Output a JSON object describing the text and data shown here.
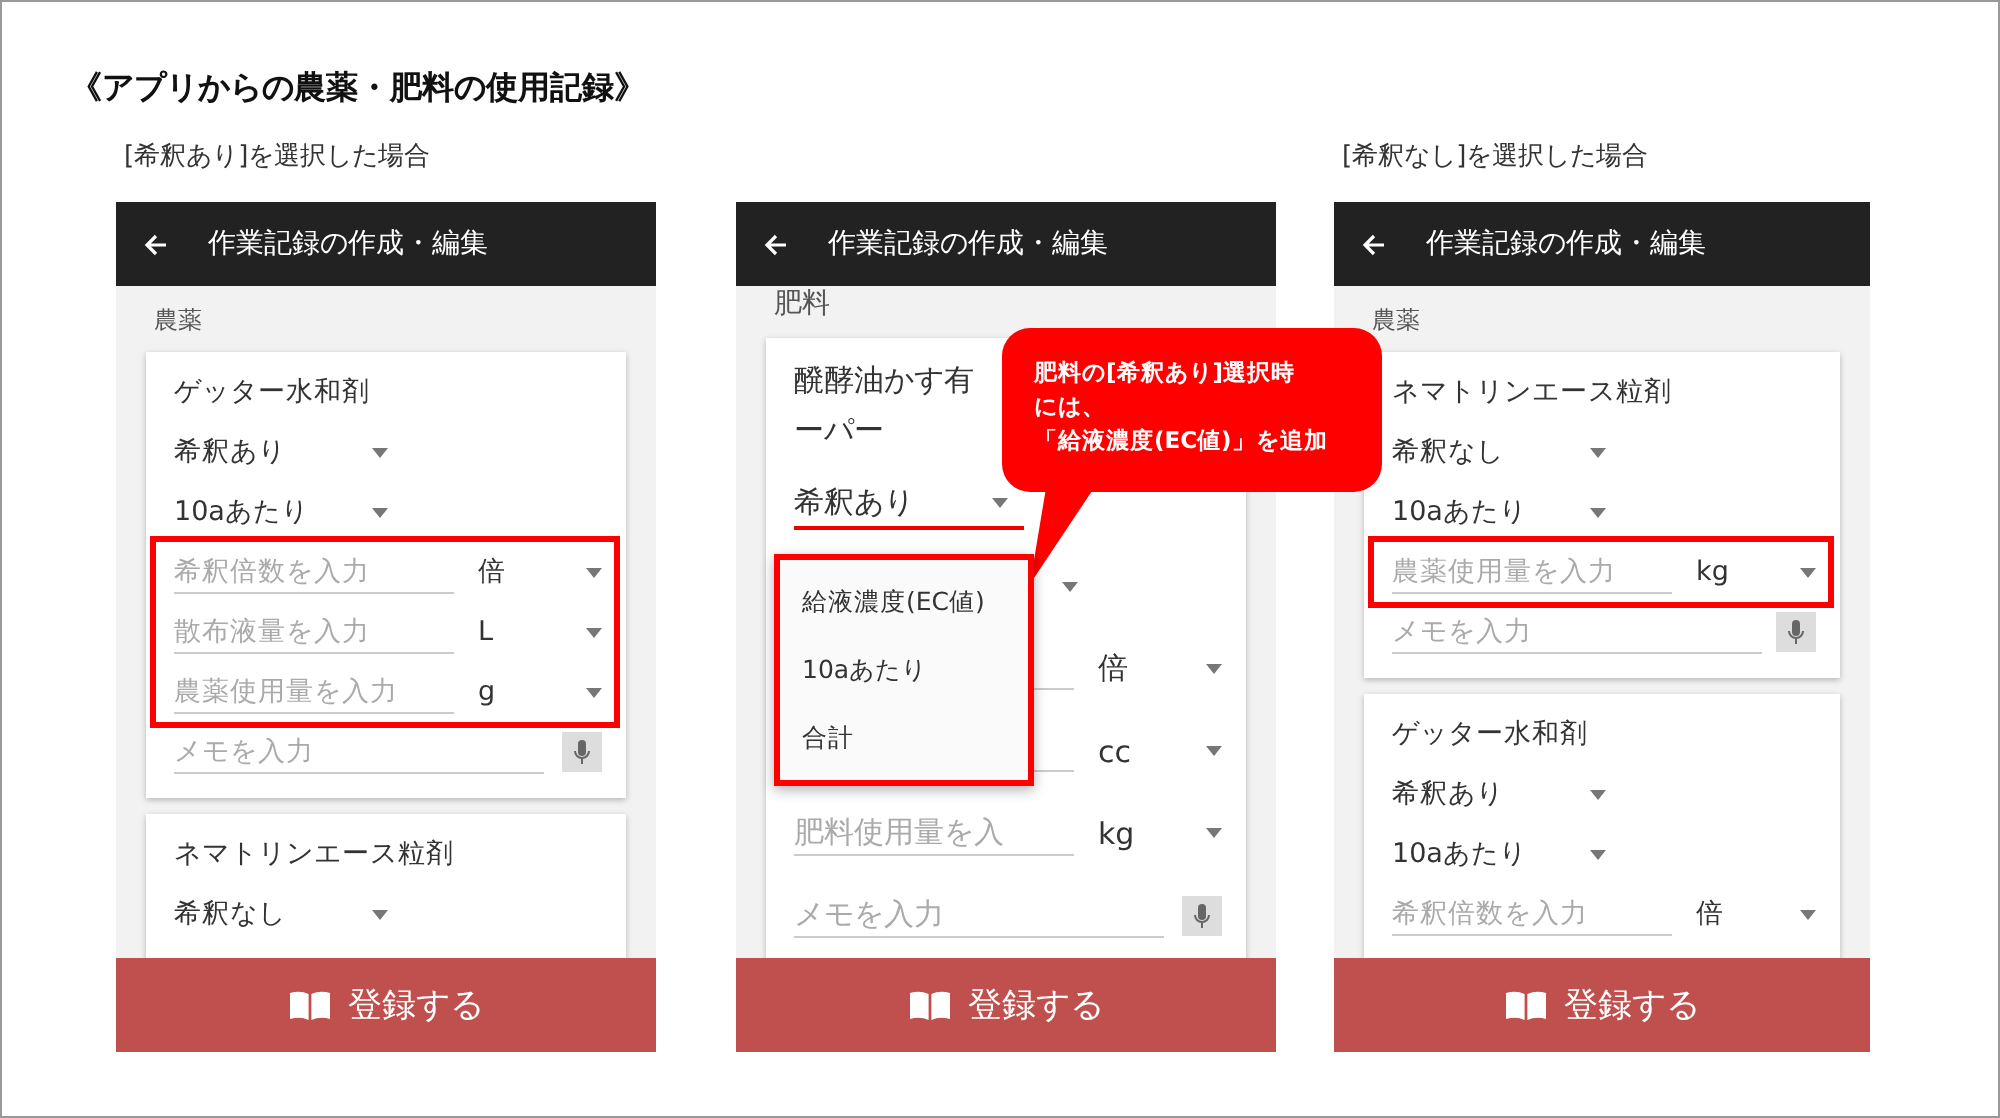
{
  "slide_title": "《アプリからの農薬・肥料の使用記録》",
  "phones": [
    {
      "caption": "[希釈あり]を選択した場合",
      "app_bar": {
        "title": "作業記録の作成・編集"
      },
      "section": "農薬",
      "cards": [
        {
          "name_lines": [
            "ゲッター水和剤"
          ],
          "rows": [
            {
              "kind": "select",
              "value": "希釈あり",
              "focused": false,
              "highlighted": false
            },
            {
              "kind": "select",
              "value": "10aあたり",
              "focused": false,
              "highlighted": false
            },
            {
              "kind": "input",
              "placeholder": "希釈倍数を入力",
              "unit": "倍",
              "highlighted": true
            },
            {
              "kind": "input",
              "placeholder": "散布液量を入力",
              "unit": "L",
              "highlighted": true
            },
            {
              "kind": "input",
              "placeholder": "農薬使用量を入力",
              "unit": "g",
              "highlighted": true
            },
            {
              "kind": "memo",
              "placeholder": "メモを入力",
              "highlighted": false
            }
          ]
        },
        {
          "name_lines": [
            "ネマトリンエース粒剤"
          ],
          "rows": [
            {
              "kind": "select",
              "value": "希釈なし",
              "focused": false,
              "highlighted": false
            }
          ]
        }
      ],
      "submit": "登録する"
    },
    {
      "app_bar": {
        "title": "作業記録の作成・編集"
      },
      "section": "肥料",
      "cards": [
        {
          "name_lines": [
            "醗酵油かす有",
            "ーパー"
          ],
          "rows": [
            {
              "kind": "select",
              "value": "希釈あり",
              "focused": true,
              "highlighted": false
            },
            {
              "kind": "select",
              "focused": false,
              "highlighted": false,
              "menu": {
                "options": [
                  "給液濃度(EC値)",
                  "10aあたり",
                  "合計"
                ],
                "highlighted": true
              }
            },
            {
              "kind": "input",
              "unit": "倍",
              "highlighted": false
            },
            {
              "kind": "input",
              "unit": "cc",
              "highlighted": false
            },
            {
              "kind": "input",
              "placeholder": "肥料使用量を入",
              "unit": "kg",
              "highlighted": false
            },
            {
              "kind": "memo",
              "placeholder": "メモを入力",
              "highlighted": false
            }
          ]
        }
      ],
      "submit": "登録する"
    },
    {
      "caption": "[希釈なし]を選択した場合",
      "app_bar": {
        "title": "作業記録の作成・編集"
      },
      "section": "農薬",
      "cards": [
        {
          "name_lines": [
            "ネマトリンエース粒剤"
          ],
          "rows": [
            {
              "kind": "select",
              "value": "希釈なし",
              "focused": false,
              "highlighted": false
            },
            {
              "kind": "select",
              "value": "10aあたり",
              "focused": false,
              "highlighted": false
            },
            {
              "kind": "input",
              "placeholder": "農薬使用量を入力",
              "unit": "kg",
              "highlighted": true
            },
            {
              "kind": "memo",
              "placeholder": "メモを入力",
              "highlighted": false
            }
          ]
        },
        {
          "name_lines": [
            "ゲッター水和剤"
          ],
          "rows": [
            {
              "kind": "select",
              "value": "希釈あり",
              "focused": false,
              "highlighted": false
            },
            {
              "kind": "select",
              "value": "10aあたり",
              "focused": false,
              "highlighted": false
            },
            {
              "kind": "input",
              "placeholder": "希釈倍数を入力",
              "unit": "倍",
              "highlighted": false
            }
          ]
        }
      ],
      "submit": "登録する"
    }
  ],
  "callout": {
    "lines": [
      "肥料の[希釈あり]選択時",
      "には、",
      "「給液濃度(EC値)」を追加"
    ]
  }
}
